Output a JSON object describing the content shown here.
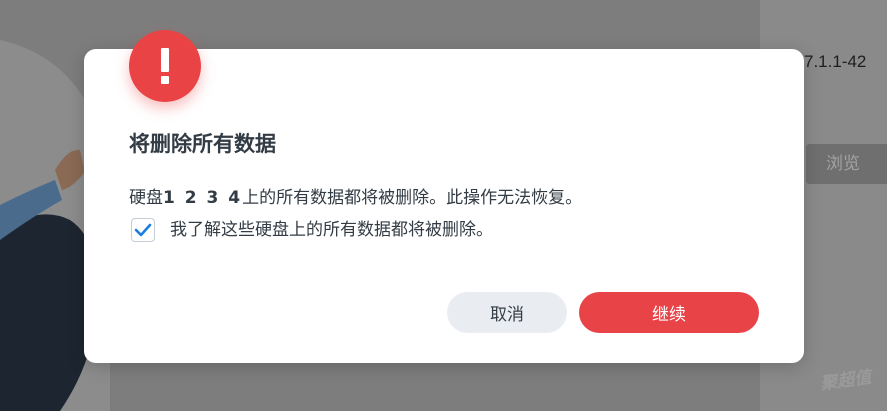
{
  "background": {
    "version_text": "7.1.1-42",
    "browse_label": "浏览",
    "watermark": "聚超值"
  },
  "dialog": {
    "title": "将删除所有数据",
    "message_prefix": "硬盘",
    "message_disks": "1 2 3 4",
    "message_suffix": "上的所有数据都将被删除。此操作无法恢复。",
    "checkbox_checked": true,
    "checkbox_label": "我了解这些硬盘上的所有数据都将被删除。",
    "cancel_label": "取消",
    "continue_label": "继续",
    "alert_icon": "exclamation-icon"
  },
  "colors": {
    "accent_red": "#e84347",
    "check_blue": "#1a7ee0",
    "text_dark": "#333c45",
    "overlay": "#7d7d7d"
  }
}
